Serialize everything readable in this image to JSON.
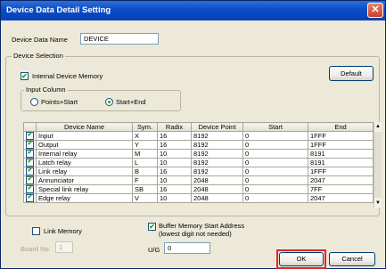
{
  "window": {
    "title": "Device Data Detail Setting",
    "close_label": "x"
  },
  "device_data_name": {
    "label": "Device Data Name",
    "value": "DEVICE"
  },
  "device_selection": {
    "label": "Device Selection",
    "internal_device_memory": {
      "label": "Internal Device Memory",
      "checked": true
    },
    "default_button": "Default",
    "input_column": {
      "label": "Input Column",
      "options": [
        {
          "label": "Points+Start",
          "selected": false
        },
        {
          "label": "Start+End",
          "selected": true
        }
      ]
    },
    "table": {
      "columns": [
        "",
        "Device Name",
        "Sym.",
        "Radix",
        "Device Point",
        "Start",
        "End"
      ],
      "rows": [
        {
          "checked": true,
          "name": "Input",
          "sym": "X",
          "radix": "16",
          "point": "8192",
          "start": "0",
          "end": "1FFF"
        },
        {
          "checked": true,
          "name": "Output",
          "sym": "Y",
          "radix": "16",
          "point": "8192",
          "start": "0",
          "end": "1FFF"
        },
        {
          "checked": true,
          "name": "Internal relay",
          "sym": "M",
          "radix": "10",
          "point": "8192",
          "start": "0",
          "end": "8191"
        },
        {
          "checked": true,
          "name": "Latch relay",
          "sym": "L",
          "radix": "10",
          "point": "8192",
          "start": "0",
          "end": "8191"
        },
        {
          "checked": true,
          "name": "Link relay",
          "sym": "B",
          "radix": "16",
          "point": "8192",
          "start": "0",
          "end": "1FFF"
        },
        {
          "checked": true,
          "name": "Annunciator",
          "sym": "F",
          "radix": "10",
          "point": "2048",
          "start": "0",
          "end": "2047"
        },
        {
          "checked": true,
          "name": "Special link relay",
          "sym": "SB",
          "radix": "16",
          "point": "2048",
          "start": "0",
          "end": "7FF"
        },
        {
          "checked": true,
          "name": "Edge relay",
          "sym": "V",
          "radix": "10",
          "point": "2048",
          "start": "0",
          "end": "2047"
        }
      ]
    }
  },
  "link_memory": {
    "label": "Link Memory",
    "checked": false
  },
  "board_no": {
    "label": "Board No.",
    "value": "1"
  },
  "buffer_memory": {
    "label_line1": "Buffer Memory Start Address",
    "label_line2": "(lowest digit not needed)",
    "checked": true
  },
  "ug": {
    "label": "U/G",
    "value": "0"
  },
  "buttons": {
    "ok": "OK",
    "cancel": "Cancel"
  },
  "colors": {
    "titlebar": "#0a4cc9",
    "dialog_bg": "#ece9d8",
    "ok_highlight": "#e0262a",
    "check_green": "#21a121"
  }
}
